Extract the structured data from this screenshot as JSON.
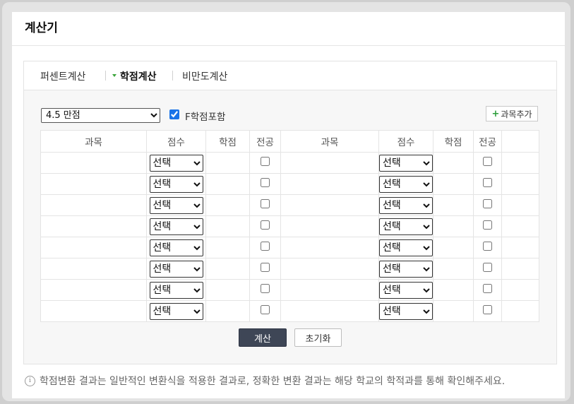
{
  "window": {
    "title": "계산기"
  },
  "tabs": [
    {
      "label": "퍼센트계산",
      "active": false
    },
    {
      "label": "학점계산",
      "active": true
    },
    {
      "label": "비만도계산",
      "active": false
    }
  ],
  "controls": {
    "scale_selected": "4.5 만점",
    "f_grade_label": "F학점포함",
    "f_grade_checked": true,
    "add_subject_label": "과목추가",
    "add_icon": "plus-icon"
  },
  "table": {
    "headers": [
      "과목",
      "점수",
      "학점",
      "전공",
      "과목",
      "점수",
      "학점",
      "전공"
    ],
    "score_placeholder": "선택",
    "row_count": 8
  },
  "buttons": {
    "calculate": "계산",
    "reset": "초기화"
  },
  "footer": {
    "icon": "info-icon",
    "note": "학점변환 결과는 일반적인 변환식을 적용한 결과로, 정확한 변환 결과는 해당 학교의 학적과를 통해 확인해주세요."
  },
  "colors": {
    "accent": "#3e4656",
    "tab_marker": "#3ba53b",
    "plus": "#2a9d3a",
    "checkbox": "#1a73e8"
  }
}
